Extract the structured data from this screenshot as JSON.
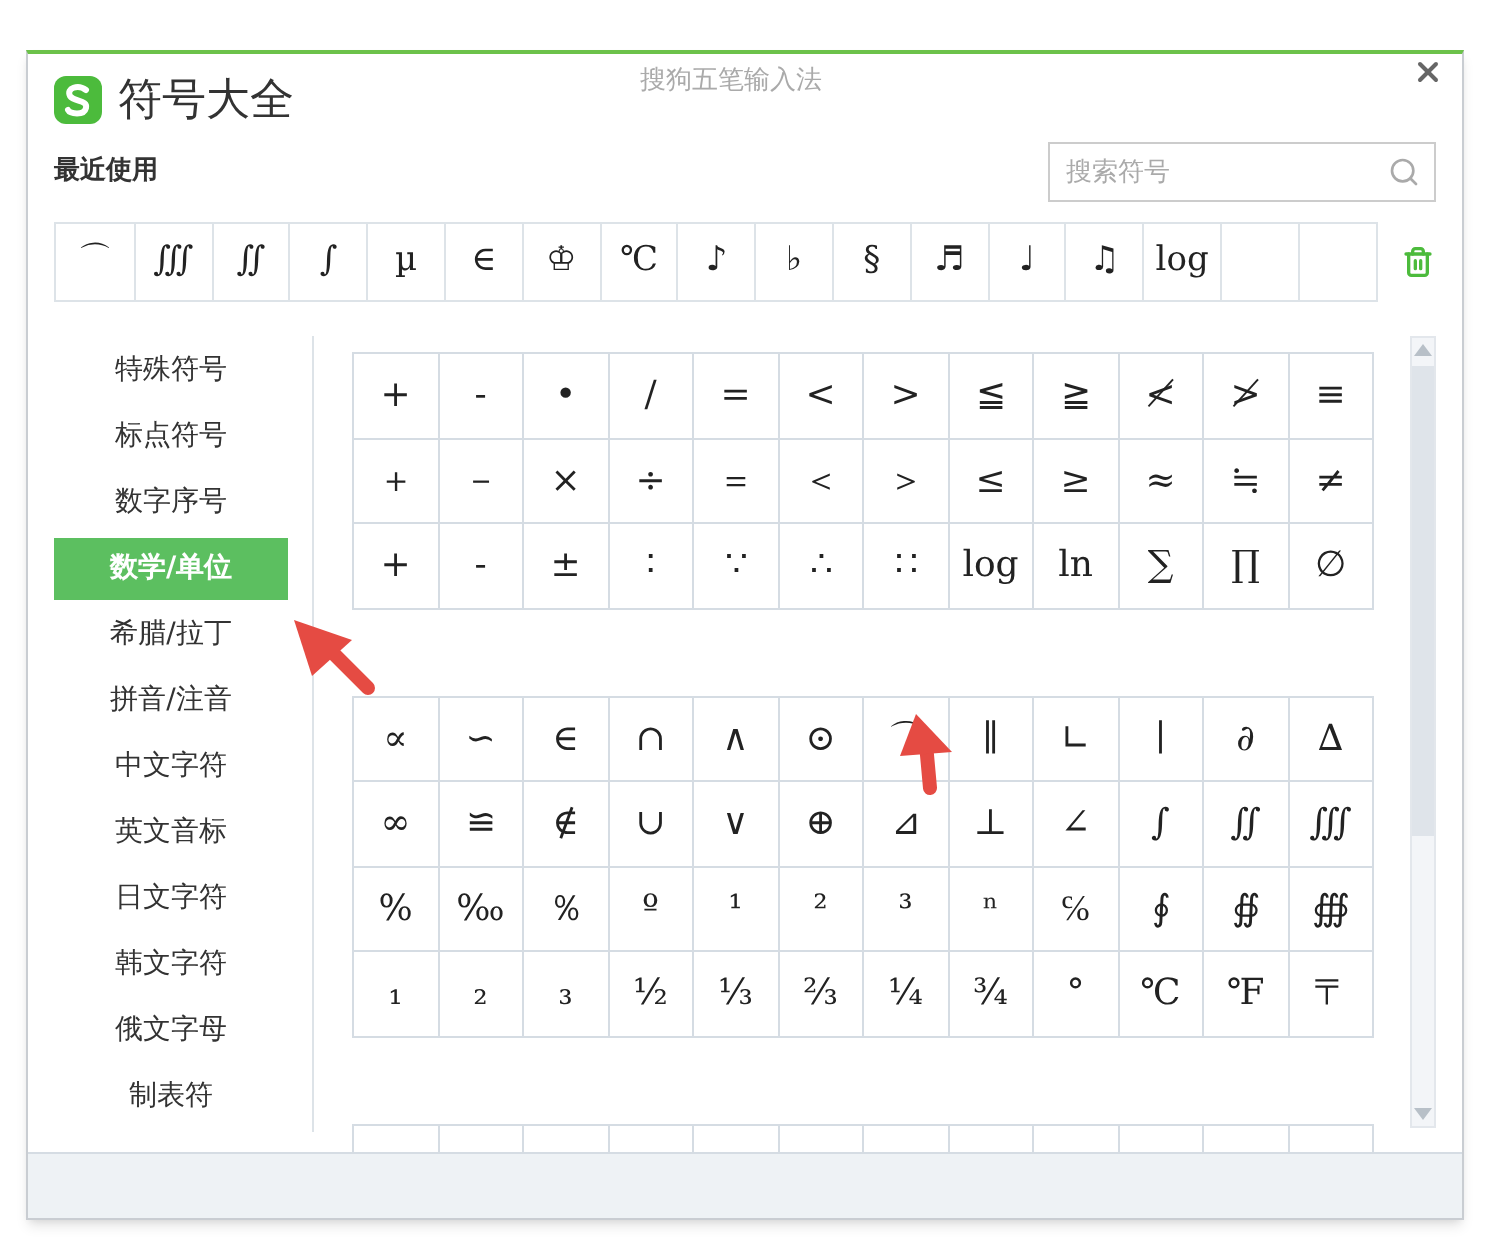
{
  "window": {
    "title": "符号大全",
    "subtitle": "搜狗五笔输入法"
  },
  "recent": {
    "label": "最近使用",
    "slots": [
      {
        "kind": "symbol",
        "text": "⌒"
      },
      {
        "kind": "symbol",
        "text": "∭"
      },
      {
        "kind": "symbol",
        "text": "∬"
      },
      {
        "kind": "symbol",
        "text": "∫"
      },
      {
        "kind": "symbol",
        "text": "µ"
      },
      {
        "kind": "symbol",
        "text": "∈"
      },
      {
        "kind": "symbol",
        "text": "♔"
      },
      {
        "kind": "symbol",
        "text": "℃"
      },
      {
        "kind": "symbol",
        "text": "♪"
      },
      {
        "kind": "symbol",
        "text": "♭"
      },
      {
        "kind": "symbol",
        "text": "§"
      },
      {
        "kind": "symbol",
        "text": "♬"
      },
      {
        "kind": "symbol",
        "text": "♩"
      },
      {
        "kind": "symbol",
        "text": "♫"
      },
      {
        "kind": "symbol",
        "text": "log"
      },
      {
        "kind": "empty"
      },
      {
        "kind": "empty"
      }
    ]
  },
  "search": {
    "placeholder": "搜索符号"
  },
  "sidebar": {
    "items": [
      {
        "label": "特殊符号",
        "selected": false
      },
      {
        "label": "标点符号",
        "selected": false
      },
      {
        "label": "数字序号",
        "selected": false
      },
      {
        "label": "数学/单位",
        "selected": true
      },
      {
        "label": "希腊/拉丁",
        "selected": false
      },
      {
        "label": "拼音/注音",
        "selected": false
      },
      {
        "label": "中文字符",
        "selected": false
      },
      {
        "label": "英文音标",
        "selected": false
      },
      {
        "label": "日文字符",
        "selected": false
      },
      {
        "label": "韩文字符",
        "selected": false
      },
      {
        "label": "俄文字母",
        "selected": false
      },
      {
        "label": "制表符",
        "selected": false
      }
    ]
  },
  "tables": [
    {
      "rows": [
        [
          "+",
          "-",
          "•",
          "/",
          "=",
          "<",
          ">",
          "≦",
          "≧",
          "≮",
          "≯",
          "≡"
        ],
        [
          "＋",
          "－",
          "×",
          "÷",
          "＝",
          "＜",
          "＞",
          "≤",
          "≥",
          "≈",
          "≒",
          "≠"
        ],
        [
          "+",
          "-",
          "±",
          "∶",
          "∵",
          "∴",
          "∷",
          "log",
          "ln",
          "∑",
          "∏",
          "∅"
        ]
      ]
    },
    {
      "rows": [
        [
          "∝",
          "∽",
          "∈",
          "∩",
          "∧",
          "⊙",
          "⌒",
          "∥",
          "∟",
          "∣",
          "∂",
          "∆"
        ],
        [
          "∞",
          "≌",
          "∉",
          "∪",
          "∨",
          "⊕",
          "⊿",
          "⊥",
          "∠",
          "∫",
          "∬",
          "∭"
        ],
        [
          "%",
          "‰",
          "％",
          "º",
          "¹",
          "²",
          "³",
          "ⁿ",
          "℅",
          "∮",
          "∯",
          "∰"
        ],
        [
          "₁",
          "₂",
          "₃",
          "½",
          "⅓",
          "⅔",
          "¼",
          "¾",
          "°",
          "℃",
          "℉",
          "〒"
        ]
      ]
    }
  ]
}
